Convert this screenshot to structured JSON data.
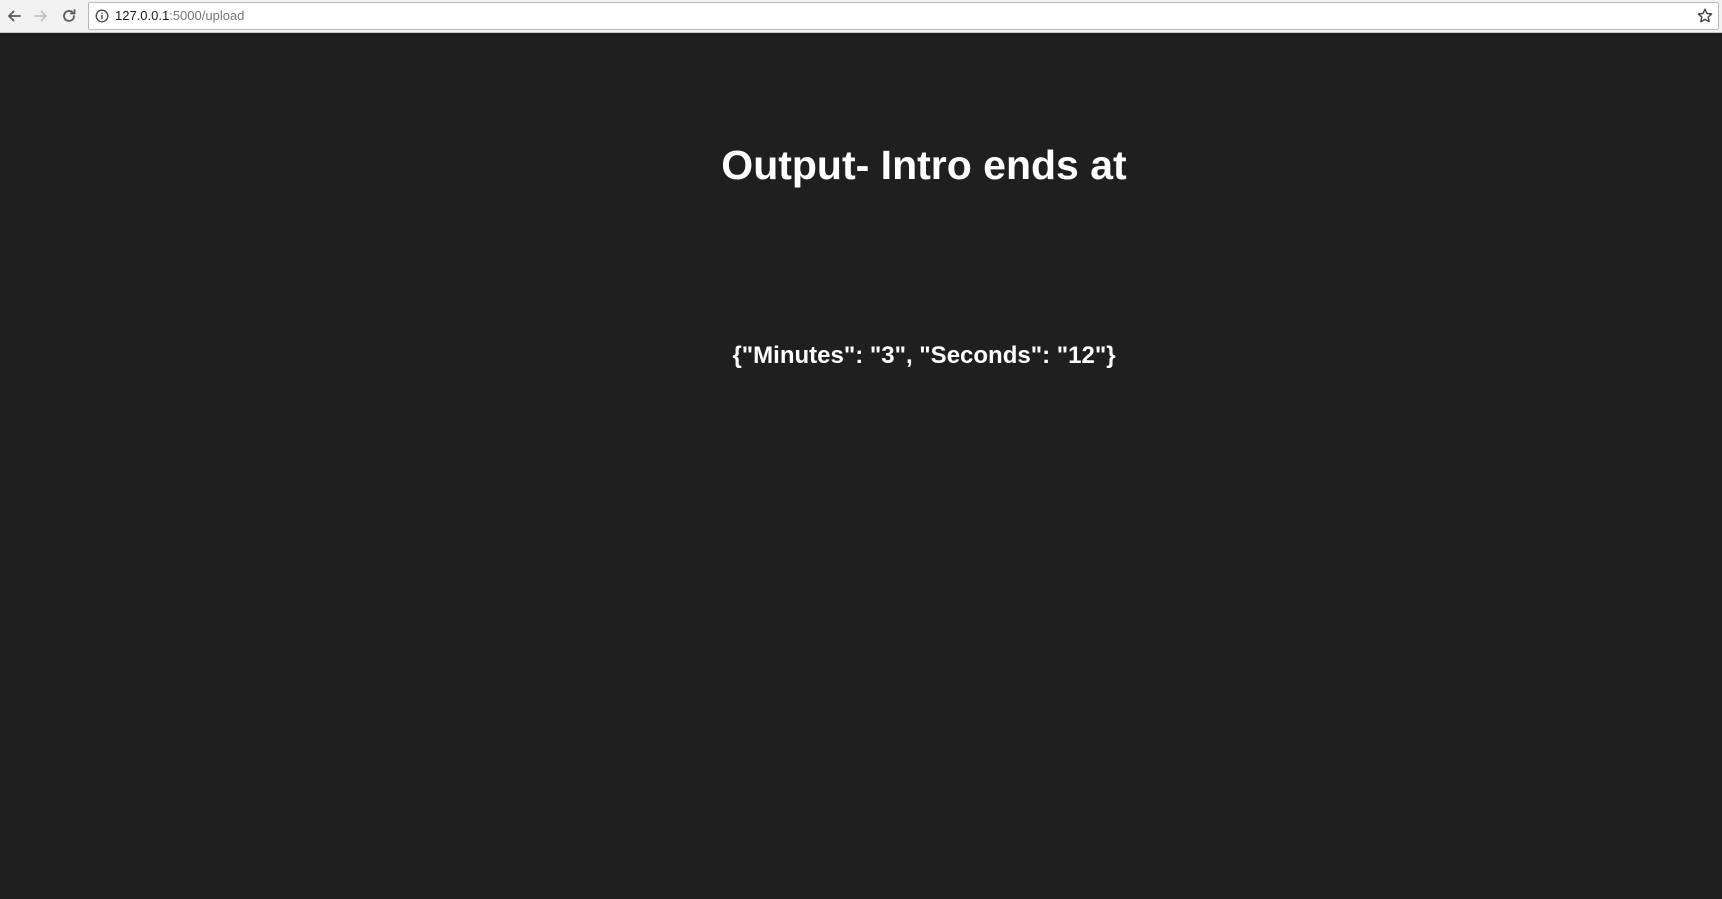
{
  "browser": {
    "url_host": "127.0.0.1",
    "url_rest": ":5000/upload",
    "icons": {
      "back": "arrow-left-icon",
      "forward": "arrow-right-icon",
      "reload": "reload-icon",
      "info": "info-icon",
      "bookmark": "star-icon"
    }
  },
  "page": {
    "heading": "Output- Intro ends at",
    "result": "{\"Minutes\": \"3\", \"Seconds\": \"12\"}",
    "background_color": "#1f1f1f",
    "text_color": "#ffffff"
  }
}
